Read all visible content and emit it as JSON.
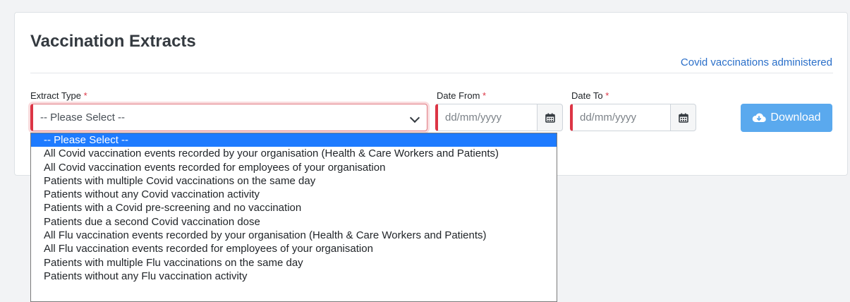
{
  "page": {
    "title": "Vaccination Extracts",
    "top_link": "Covid vaccinations administered"
  },
  "form": {
    "required_marker": "*",
    "extract_type": {
      "label": "Extract Type",
      "value": "-- Please Select --"
    },
    "date_from": {
      "label": "Date From",
      "placeholder": "dd/mm/yyyy"
    },
    "date_to": {
      "label": "Date To",
      "placeholder": "dd/mm/yyyy"
    },
    "download_label": "Download"
  },
  "dropdown": {
    "options": [
      "-- Please Select --",
      "All Covid vaccination events recorded by your organisation (Health & Care Workers and Patients)",
      "All Covid vaccination events recorded for employees of your organisation",
      "Patients with multiple Covid vaccinations on the same day",
      "Patients without any Covid vaccination activity",
      "Patients with a Covid pre-screening and no vaccination",
      "Patients due a second Covid vaccination dose",
      "All Flu vaccination events recorded by your organisation (Health & Care Workers and Patients)",
      "All Flu vaccination events recorded for employees of your organisation",
      "Patients with multiple Flu vaccinations on the same day",
      "Patients without any Flu vaccination activity"
    ],
    "selected_index": 0
  },
  "icons": {
    "calendar": "calendar-icon",
    "cloud_download": "cloud-download-icon",
    "chevron": "chevron-down-icon"
  },
  "colors": {
    "required": "#dc3545",
    "link": "#2a6fc9",
    "primary_button": "#5aa9ee",
    "selected_option": "#1e7bff"
  }
}
